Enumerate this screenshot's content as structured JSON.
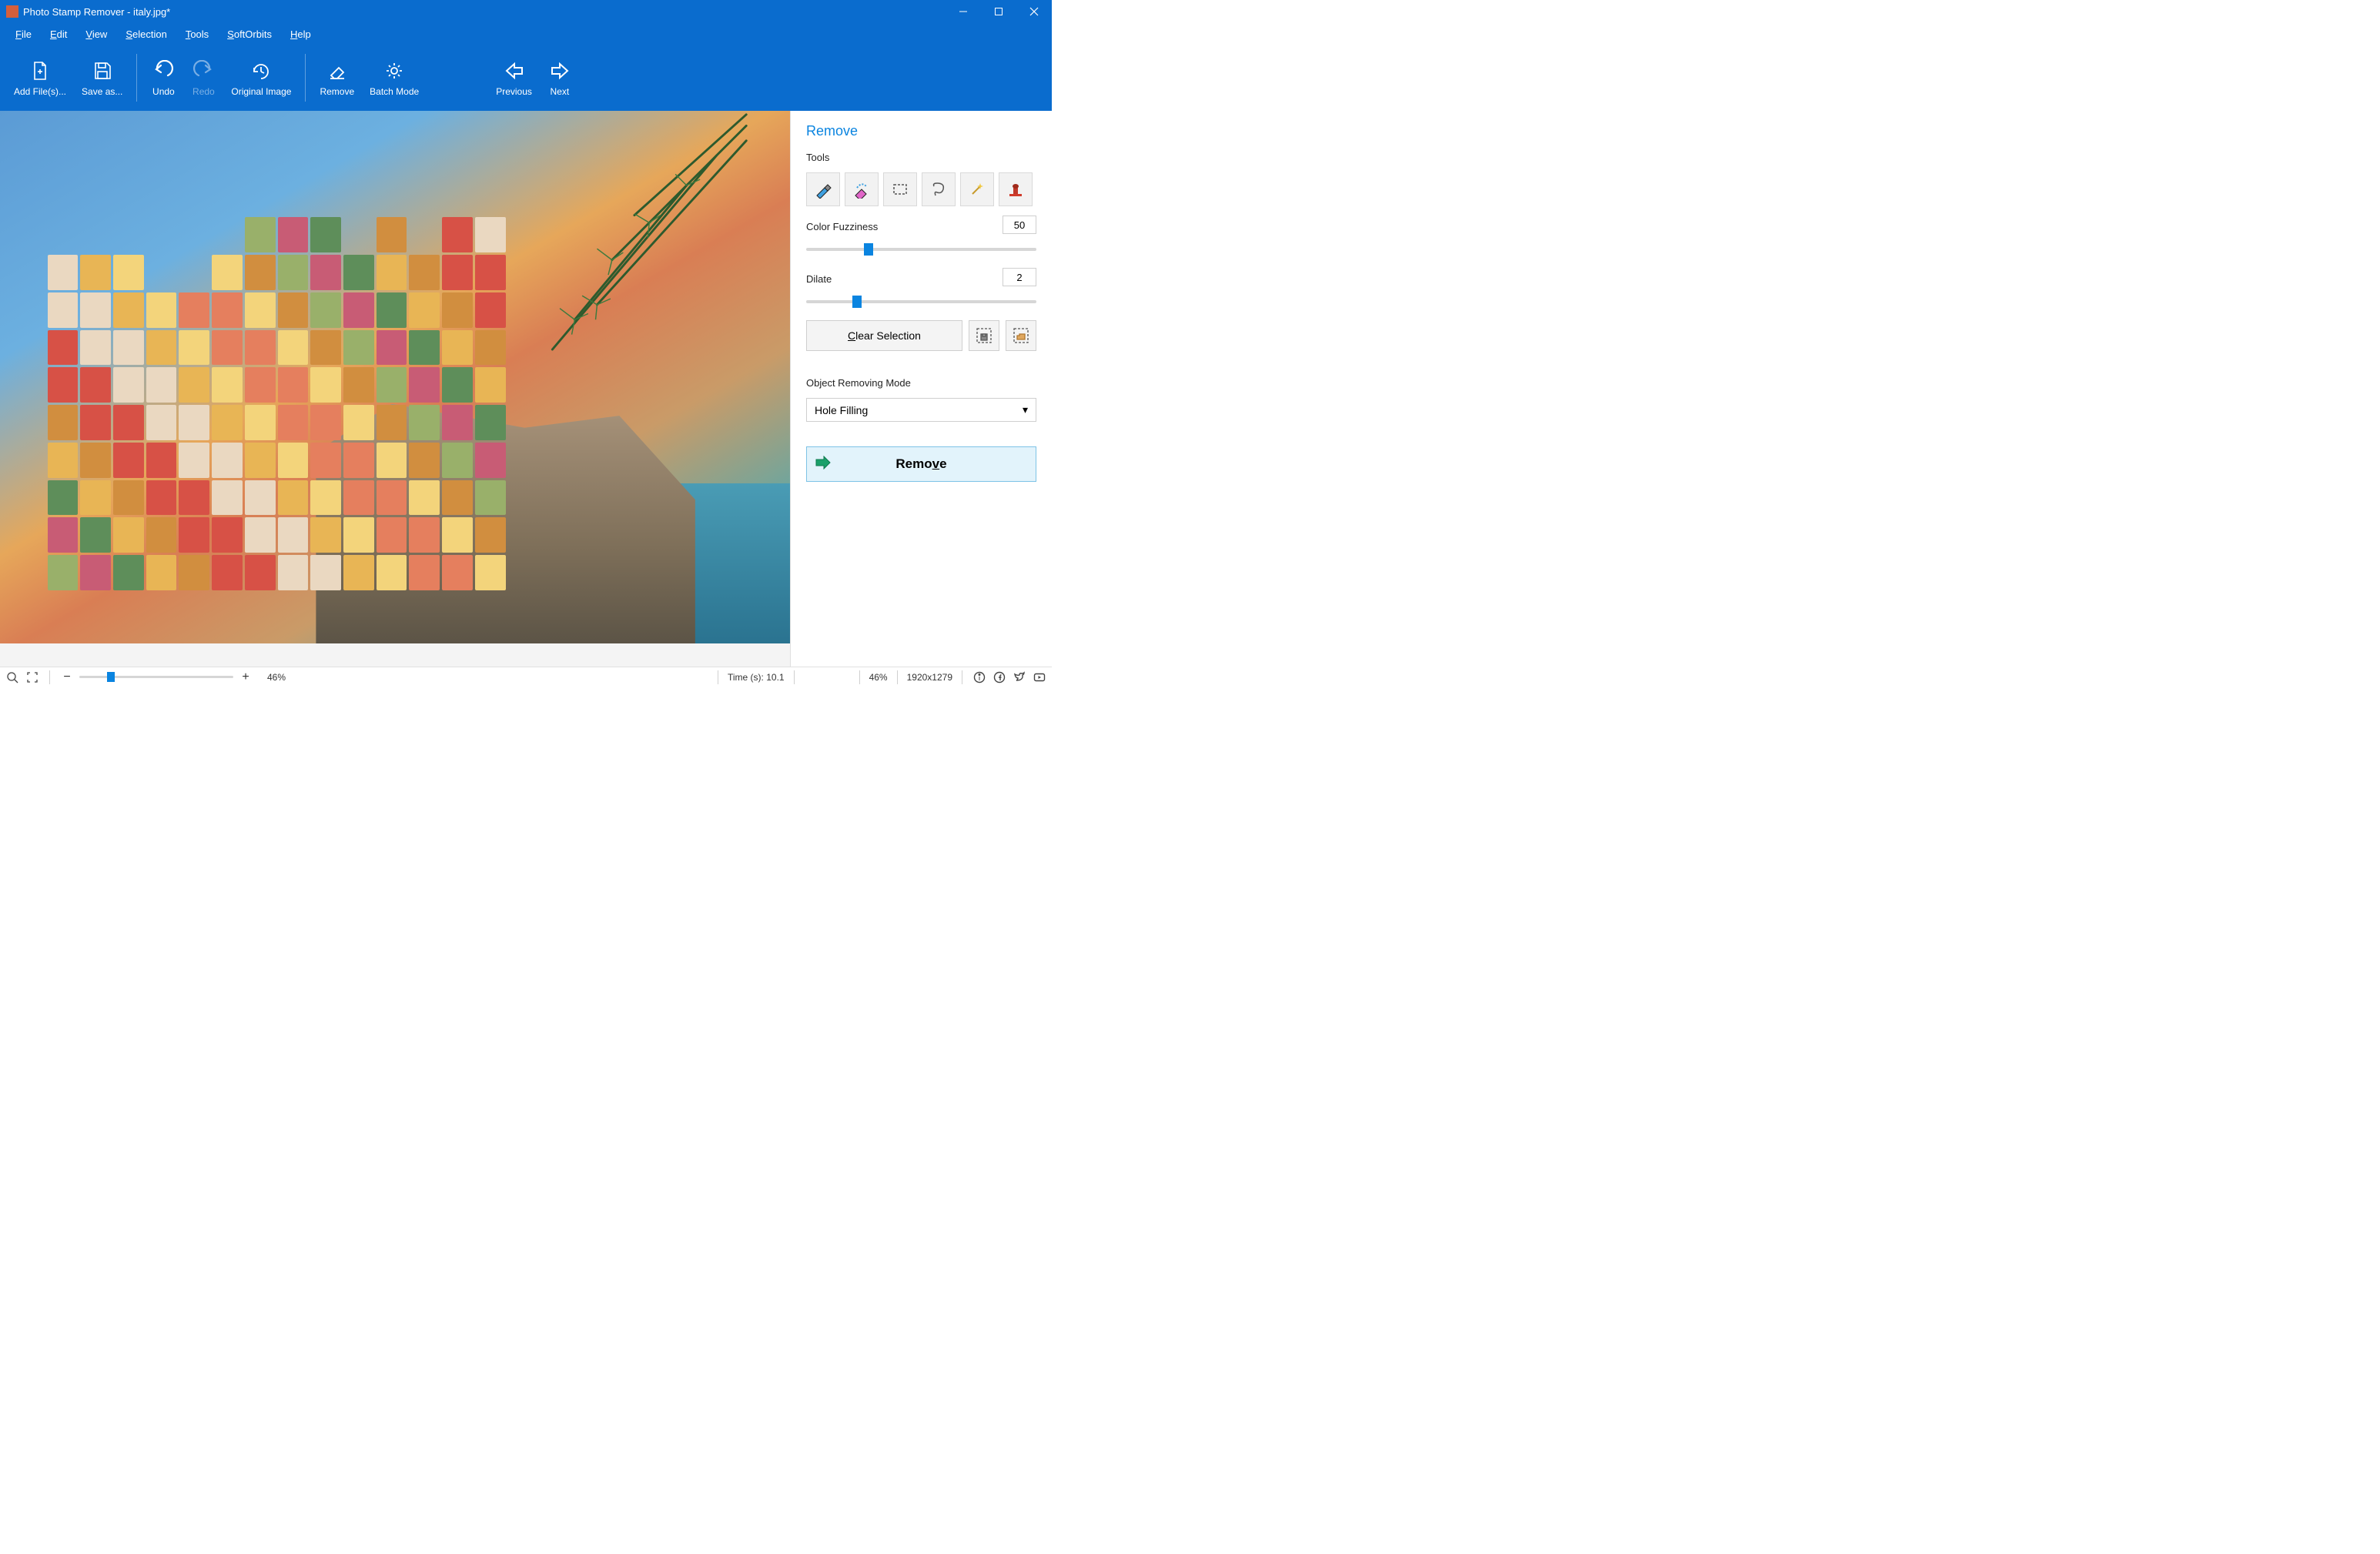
{
  "titlebar": {
    "app_title": "Photo Stamp Remover - italy.jpg*"
  },
  "menu": {
    "file": "File",
    "edit": "Edit",
    "view": "View",
    "selection": "Selection",
    "tools": "Tools",
    "softorbits": "SoftOrbits",
    "help": "Help"
  },
  "toolbar": {
    "add_file": "Add File(s)...",
    "save_as": "Save as...",
    "undo": "Undo",
    "redo": "Redo",
    "original_image": "Original Image",
    "remove": "Remove",
    "batch_mode": "Batch Mode",
    "previous": "Previous",
    "next": "Next"
  },
  "sidepanel": {
    "panel_title": "Remove",
    "tools_label": "Tools",
    "color_fuzziness_label": "Color Fuzziness",
    "color_fuzziness_value": "50",
    "dilate_label": "Dilate",
    "dilate_value": "2",
    "clear_selection": "Clear Selection",
    "object_removing_mode": "Object Removing Mode",
    "mode_selected": "Hole Filling",
    "remove_button": "Remove"
  },
  "status": {
    "zoom_pct": "46%",
    "time_label": "Time (s): 10.1",
    "zoom_pct2": "46%",
    "dimensions": "1920x1279"
  },
  "colors": {
    "brand_blue": "#0a6cce",
    "accent_blue": "#0a84e0"
  }
}
